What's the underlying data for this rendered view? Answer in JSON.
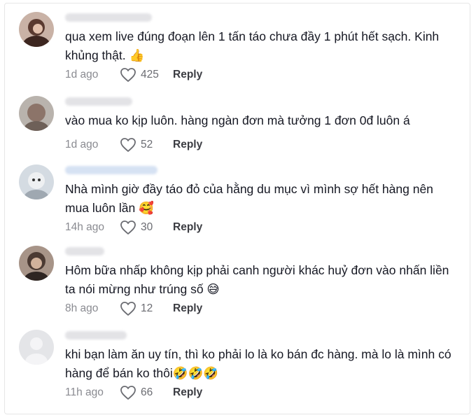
{
  "comments": [
    {
      "text": "qua xem live đúng đoạn lên 1 tấn táo chưa đầy 1 phút hết sạch. Kinh khủng thật. 👍",
      "time": "1d ago",
      "likes": "425",
      "reply": "Reply"
    },
    {
      "text": "vào mua ko kịp luôn. hàng ngàn đơn mà tưởng 1 đơn 0đ luôn á",
      "time": "1d ago",
      "likes": "52",
      "reply": "Reply"
    },
    {
      "text": "Nhà mình giờ đầy táo đỏ của hằng du mục vì mình sợ hết hàng nên mua luôn lần 🥰",
      "time": "14h ago",
      "likes": "30",
      "reply": "Reply"
    },
    {
      "text": "Hôm bữa nhấp không kịp phải canh người khác huỷ đơn vào nhấn liền ta nói mừng như trúng số 😅",
      "time": "8h ago",
      "likes": "12",
      "reply": "Reply"
    },
    {
      "text": "khi bạn làm ăn uy tín, thì ko phải lo là ko bán đc hàng. mà lo là mình có hàng để bán ko thôi🤣🤣🤣",
      "time": "11h ago",
      "likes": "66",
      "reply": "Reply"
    }
  ],
  "colors": {
    "text": "#161823",
    "meta": "#8a8b91",
    "reply": "#3b3c42"
  },
  "icons": [
    "avatar",
    "heart-outline-icon"
  ]
}
